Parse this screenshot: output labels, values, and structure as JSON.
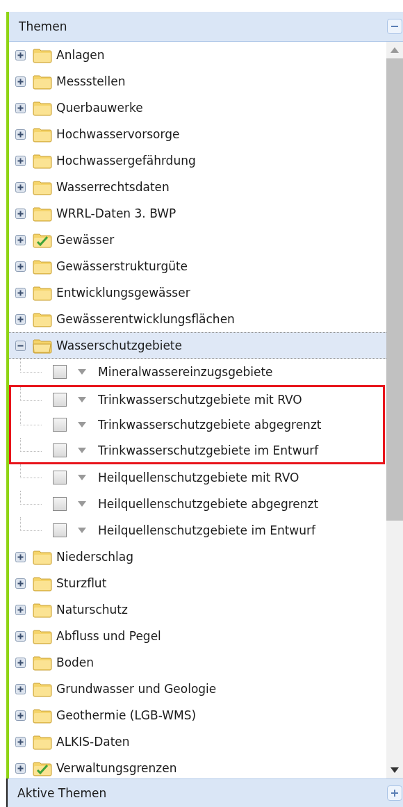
{
  "themes_panel": {
    "title": "Themen",
    "expanded": true,
    "items": [
      {
        "label": "Anlagen",
        "expanded": false,
        "checked": false,
        "selected": false
      },
      {
        "label": "Messstellen",
        "expanded": false,
        "checked": false,
        "selected": false
      },
      {
        "label": "Querbauwerke",
        "expanded": false,
        "checked": false,
        "selected": false
      },
      {
        "label": "Hochwasservorsorge",
        "expanded": false,
        "checked": false,
        "selected": false
      },
      {
        "label": "Hochwassergefährdung",
        "expanded": false,
        "checked": false,
        "selected": false
      },
      {
        "label": "Wasserrechtsdaten",
        "expanded": false,
        "checked": false,
        "selected": false
      },
      {
        "label": "WRRL-Daten 3. BWP",
        "expanded": false,
        "checked": false,
        "selected": false
      },
      {
        "label": "Gewässer",
        "expanded": false,
        "checked": true,
        "selected": false
      },
      {
        "label": "Gewässerstrukturgüte",
        "expanded": false,
        "checked": false,
        "selected": false
      },
      {
        "label": "Entwicklungsgewässer",
        "expanded": false,
        "checked": false,
        "selected": false
      },
      {
        "label": "Gewässerentwicklungsflächen",
        "expanded": false,
        "checked": false,
        "selected": false
      },
      {
        "label": "Wasserschutzgebiete",
        "expanded": true,
        "checked": false,
        "selected": true,
        "children": [
          {
            "label": "Mineralwassereinzugsgebiete",
            "checked": false,
            "marked": false
          },
          {
            "label": "Trinkwasserschutzgebiete mit RVO",
            "checked": false,
            "marked": true
          },
          {
            "label": "Trinkwasserschutzgebiete abgegrenzt",
            "checked": false,
            "marked": true
          },
          {
            "label": "Trinkwasserschutzgebiete im Entwurf",
            "checked": false,
            "marked": true
          },
          {
            "label": "Heilquellenschutzgebiete mit RVO",
            "checked": false,
            "marked": false
          },
          {
            "label": "Heilquellenschutzgebiete abgegrenzt",
            "checked": false,
            "marked": false
          },
          {
            "label": "Heilquellenschutzgebiete im Entwurf",
            "checked": false,
            "marked": false
          }
        ]
      },
      {
        "label": "Niederschlag",
        "expanded": false,
        "checked": false,
        "selected": false
      },
      {
        "label": "Sturzflut",
        "expanded": false,
        "checked": false,
        "selected": false
      },
      {
        "label": "Naturschutz",
        "expanded": false,
        "checked": false,
        "selected": false
      },
      {
        "label": "Abfluss und Pegel",
        "expanded": false,
        "checked": false,
        "selected": false
      },
      {
        "label": "Boden",
        "expanded": false,
        "checked": false,
        "selected": false
      },
      {
        "label": "Grundwasser und Geologie",
        "expanded": false,
        "checked": false,
        "selected": false
      },
      {
        "label": "Geothermie (LGB-WMS)",
        "expanded": false,
        "checked": false,
        "selected": false
      },
      {
        "label": "ALKIS-Daten",
        "expanded": false,
        "checked": false,
        "selected": false
      },
      {
        "label": "Verwaltungsgrenzen",
        "expanded": false,
        "checked": true,
        "selected": false
      }
    ]
  },
  "active_panel": {
    "title": "Aktive Themen",
    "expanded": false
  }
}
